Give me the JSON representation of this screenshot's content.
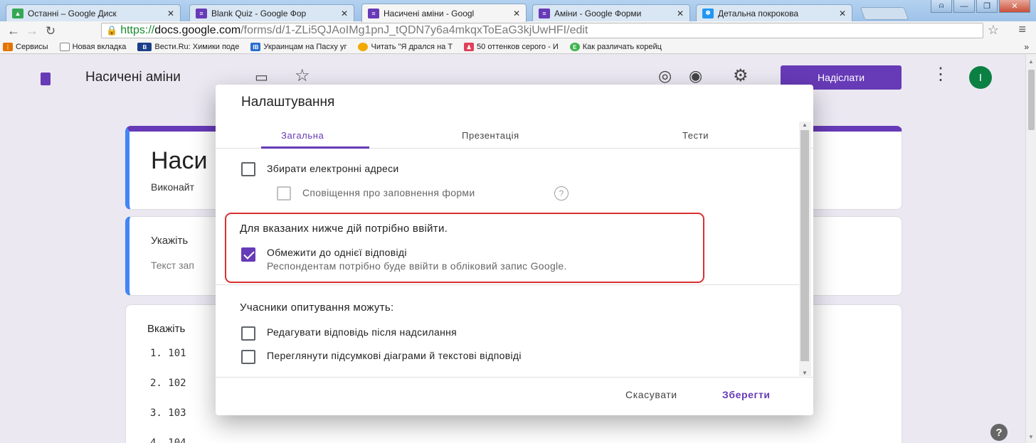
{
  "browser": {
    "tabs": [
      {
        "title": "Останні – Google Диск",
        "icon": "google-drive-icon",
        "color": "#34a853"
      },
      {
        "title": "Blank Quiz - Google Фор",
        "icon": "google-forms-icon",
        "color": "#673ab7"
      },
      {
        "title": "Насичені аміни - Googl",
        "icon": "google-forms-icon",
        "color": "#673ab7",
        "active": true
      },
      {
        "title": "Аміни - Google Форми",
        "icon": "google-forms-icon",
        "color": "#673ab7"
      },
      {
        "title": "Детальна покрокова",
        "icon": "snowflake-icon",
        "color": "#2196f3"
      }
    ],
    "url": {
      "scheme": "https://",
      "host": "docs.google.com",
      "path": "/forms/d/1-ZLi5QJAoIMg1pnJ_tQDN7y6a4mkqxToEaG3kjUwHFI/edit"
    },
    "bookmarks": [
      {
        "label": "Сервисы",
        "icon": "apps-grid-icon",
        "color": "#e37400"
      },
      {
        "label": "Новая вкладка",
        "icon": "page-icon",
        "color": "#888888"
      },
      {
        "label": "Вести.Ru: Химики поде",
        "icon": "vesti-icon",
        "color": "#1a3f8a"
      },
      {
        "label": "Украинцам на Пасху уг",
        "icon": "ib-icon",
        "color": "#2a6fd0"
      },
      {
        "label": "Читать \"Я дрался на Т",
        "icon": "circle-icon",
        "color": "#f2a900"
      },
      {
        "label": "50 оттенков серого - И",
        "icon": "dress-icon",
        "color": "#e0405a"
      },
      {
        "label": "Как различать корейц",
        "icon": "e-icon",
        "color": "#3fb34f"
      }
    ],
    "bookmarks_more": "»"
  },
  "form_header": {
    "title": "Насичені аміни",
    "send_label": "Надіслати",
    "avatar_letter": "I",
    "accent": "#673ab7"
  },
  "form_cards": {
    "title_partial": "Наси",
    "description_partial": "Виконайт",
    "question1_partial": "Укажіть",
    "answer_placeholder_partial": "Текст зап",
    "question2_partial": "Вкажіть",
    "options": [
      "1.  101",
      "2.  102",
      "3.  103",
      "4.  104"
    ]
  },
  "dialog": {
    "title": "Налаштування",
    "tabs": [
      "Загальна",
      "Презентація",
      "Тести"
    ],
    "collect_emails": "Збирати електронні адреси",
    "notify_responses": "Сповіщення про заповнення форми",
    "requires_signin_heading": "Для вказаних нижче дій потрібно ввійти.",
    "limit_one": "Обмежити до однієї відповіді",
    "limit_one_note": "Респондентам потрібно буде ввійти в обліковий запис Google.",
    "respondents_can": "Учасники опитування можуть:",
    "edit_after": "Редагувати відповідь після надсилання",
    "see_summary": "Переглянути підсумкові діаграми й текстові відповіді",
    "cancel_label": "Скасувати",
    "save_label": "Зберегти"
  }
}
